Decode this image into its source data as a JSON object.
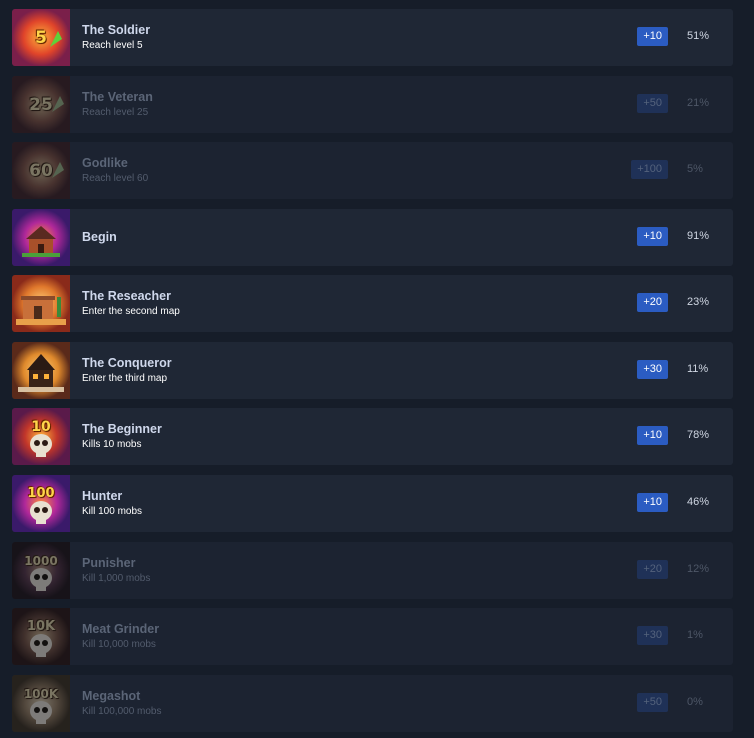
{
  "achievements": [
    {
      "title": "The Soldier",
      "subtitle": "Reach level 5",
      "reward": "+10",
      "percent": "51%",
      "locked": false,
      "icon_label": "5",
      "icon_name": "level-5-arrow-icon",
      "icon_color": "#d9442a"
    },
    {
      "title": "The Veteran",
      "subtitle": "Reach level 25",
      "reward": "+50",
      "percent": "21%",
      "locked": true,
      "icon_label": "25",
      "icon_name": "level-25-arrow-icon",
      "icon_color": "#d9442a"
    },
    {
      "title": "Godlike",
      "subtitle": "Reach level 60",
      "reward": "+100",
      "percent": "5%",
      "locked": true,
      "icon_label": "60",
      "icon_name": "level-60-arrow-icon",
      "icon_color": "#d9442a"
    },
    {
      "title": "Begin",
      "subtitle": "",
      "reward": "+10",
      "percent": "91%",
      "locked": false,
      "icon_label": "",
      "icon_name": "house-icon",
      "icon_color": "#7a2fa0"
    },
    {
      "title": "The Reseacher",
      "subtitle": "Enter the second map",
      "reward": "+20",
      "percent": "23%",
      "locked": false,
      "icon_label": "",
      "icon_name": "desert-hut-icon",
      "icon_color": "#e0782c"
    },
    {
      "title": "The Conqueror",
      "subtitle": "Enter the third map",
      "reward": "+30",
      "percent": "11%",
      "locked": false,
      "icon_label": "",
      "icon_name": "haunted-house-icon",
      "icon_color": "#e08a2c"
    },
    {
      "title": "The Beginner",
      "subtitle": "Kills 10 mobs",
      "reward": "+10",
      "percent": "78%",
      "locked": false,
      "icon_label": "10",
      "icon_name": "skull-10-icon",
      "icon_color": "#c2362a"
    },
    {
      "title": "Hunter",
      "subtitle": "Kill 100 mobs",
      "reward": "+10",
      "percent": "46%",
      "locked": false,
      "icon_label": "100",
      "icon_name": "skull-100-icon",
      "icon_color": "#b0289a"
    },
    {
      "title": "Punisher",
      "subtitle": "Kill 1,000 mobs",
      "reward": "+20",
      "percent": "12%",
      "locked": true,
      "icon_label": "1000",
      "icon_name": "skull-1000-icon",
      "icon_color": "#8a3a8a"
    },
    {
      "title": "Meat Grinder",
      "subtitle": "Kill 10,000 mobs",
      "reward": "+30",
      "percent": "1%",
      "locked": true,
      "icon_label": "10K",
      "icon_name": "skull-10k-icon",
      "icon_color": "#c24a2a"
    },
    {
      "title": "Megashot",
      "subtitle": "Kill 100,000 mobs",
      "reward": "+50",
      "percent": "0%",
      "locked": true,
      "icon_label": "100K",
      "icon_name": "skull-100k-icon",
      "icon_color": "#c87a2a"
    }
  ]
}
